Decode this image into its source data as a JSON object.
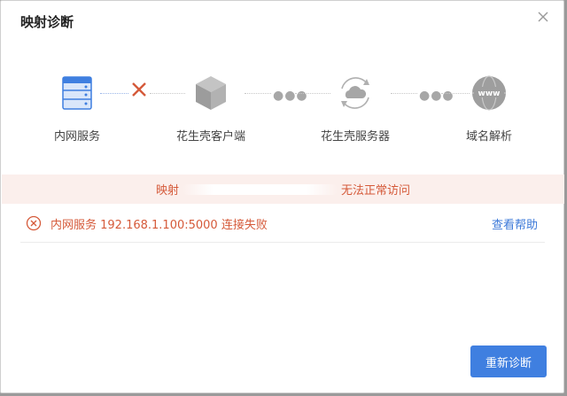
{
  "dialog": {
    "title": "映射诊断"
  },
  "steps": [
    {
      "label": "内网服务",
      "icon": "server-icon"
    },
    {
      "label": "花生壳客户端",
      "icon": "box-icon"
    },
    {
      "label": "花生壳服务器",
      "icon": "cloud-sync-icon"
    },
    {
      "label": "域名解析",
      "icon": "www-globe-icon"
    }
  ],
  "banner": {
    "prefix": "映射",
    "suffix": "无法正常访问"
  },
  "error": {
    "message": "内网服务 192.168.1.100:5000 连接失败",
    "help_label": "查看帮助"
  },
  "actions": {
    "rediagnose_label": "重新诊断"
  },
  "colors": {
    "accent": "#3f7fe0",
    "error": "#d55a3a",
    "banner_bg": "#fbefec"
  }
}
